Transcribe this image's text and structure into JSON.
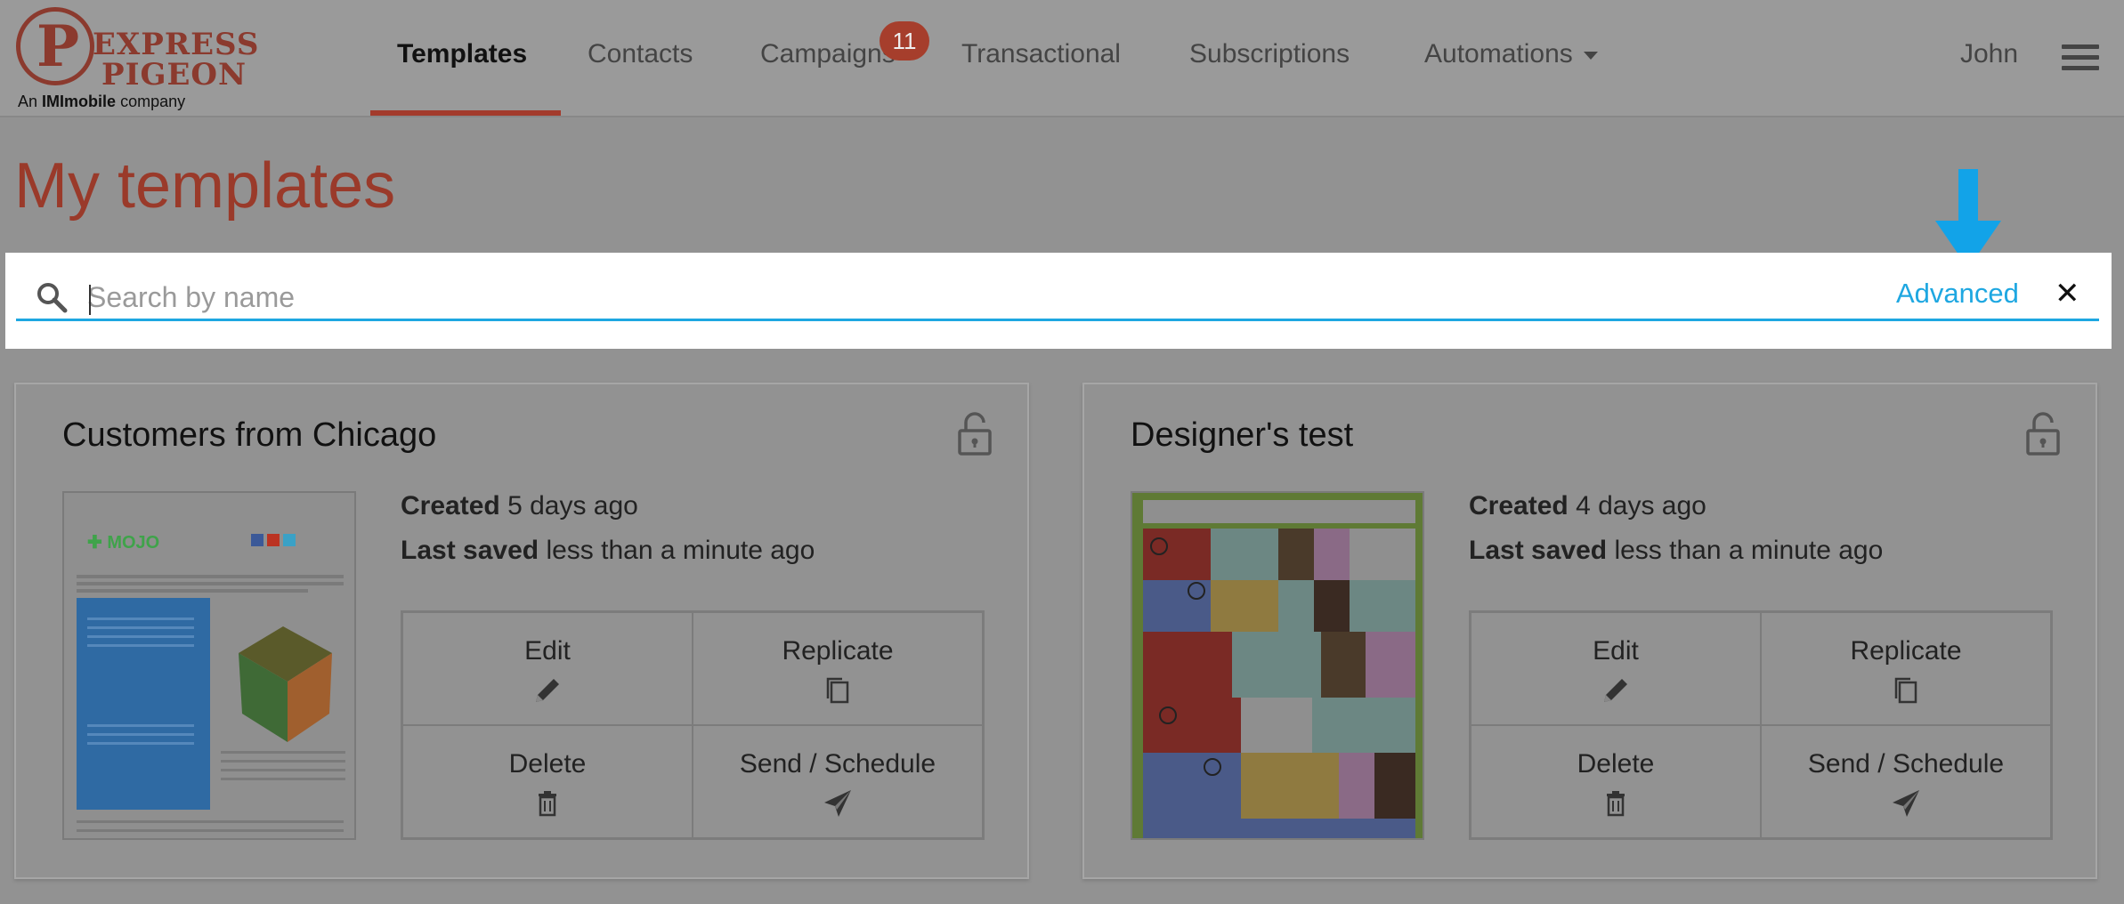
{
  "brand": {
    "line1": "EXPRESS",
    "line2": "PIGEON",
    "tag_prefix": "An",
    "tag_bold": "IMImobile",
    "tag_suffix": "company"
  },
  "nav": {
    "items": [
      {
        "label": "Templates",
        "active": true
      },
      {
        "label": "Contacts"
      },
      {
        "label": "Campaigns",
        "badge": "11"
      },
      {
        "label": "Transactional"
      },
      {
        "label": "Subscriptions"
      },
      {
        "label": "Automations"
      }
    ],
    "user": "John"
  },
  "page": {
    "title": "My templates"
  },
  "search": {
    "placeholder": "Search by name",
    "value": "",
    "advanced_label": "Advanced",
    "close_label": "✕"
  },
  "templates": [
    {
      "name": "Customers from Chicago",
      "created_label": "Created",
      "created_value": "5 days ago",
      "saved_label": "Last saved",
      "saved_value": "less than a minute ago",
      "actions": [
        "Edit",
        "Replicate",
        "Delete",
        "Send / Schedule"
      ]
    },
    {
      "name": "Designer's test",
      "created_label": "Created",
      "created_value": "4 days ago",
      "saved_label": "Last saved",
      "saved_value": "less than a minute ago",
      "actions": [
        "Edit",
        "Replicate",
        "Delete",
        "Send / Schedule"
      ]
    }
  ],
  "colors": {
    "brand": "#a33b2c",
    "accent": "#1ea7e1",
    "overlay": "#929292"
  },
  "icons": {
    "search": "search-icon",
    "lock": "lock-icon",
    "edit": "pencil-icon",
    "replicate": "copy-icon",
    "delete": "trash-icon",
    "send": "paper-plane-icon",
    "menu": "hamburger-icon",
    "indicator": "arrow-down-icon"
  }
}
